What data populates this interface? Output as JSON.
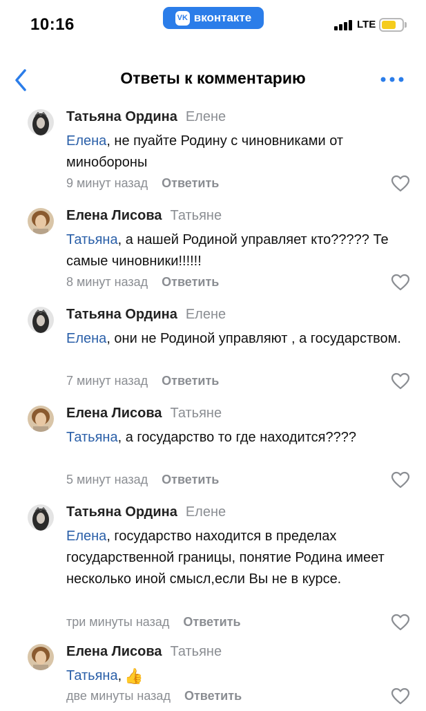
{
  "status_bar": {
    "time": "10:16",
    "app_badge": "вконтакте",
    "network": "LTE",
    "accent_color": "#2b7de9",
    "battery_color": "#f5cc1c"
  },
  "header": {
    "title": "Ответы к комментарию",
    "back_icon": "chevron-left-icon",
    "more_icon": "more-dots-icon"
  },
  "comments": [
    {
      "author": "Татьяна Ордина",
      "reply_to": "Елене",
      "mention": "Елена",
      "text": ", не пуайте Родину с чиновниками от минобороны",
      "time": "9 минут назад",
      "reply_label": "Ответить"
    },
    {
      "author": "Елена Лисова",
      "reply_to": "Татьяне",
      "mention": "Татьяна",
      "text": ", а нашей Родиной управляет кто????? Те самые чиновники!!!!!!",
      "time": "8 минут назад",
      "reply_label": "Ответить"
    },
    {
      "author": "Татьяна Ордина",
      "reply_to": "Елене",
      "mention": "Елена",
      "text": ", они не Родиной управляют , а государством.",
      "time": "7 минут назад",
      "reply_label": "Ответить"
    },
    {
      "author": "Елена Лисова",
      "reply_to": "Татьяне",
      "mention": "Татьяна",
      "text": ", а государство то где находится????",
      "time": "5 минут назад",
      "reply_label": "Ответить"
    },
    {
      "author": "Татьяна Ордина",
      "reply_to": "Елене",
      "mention": "Елена",
      "text": ", государство находится в пределах государственной границы, понятие Родина имеет несколько иной смысл,если Вы не в курсе.",
      "time": "три минуты назад",
      "reply_label": "Ответить"
    },
    {
      "author": "Елена Лисова",
      "reply_to": "Татьяне",
      "mention": "Татьяна",
      "text": ",",
      "emoji": "👍",
      "time": "две минуты назад",
      "reply_label": "Ответить"
    }
  ]
}
